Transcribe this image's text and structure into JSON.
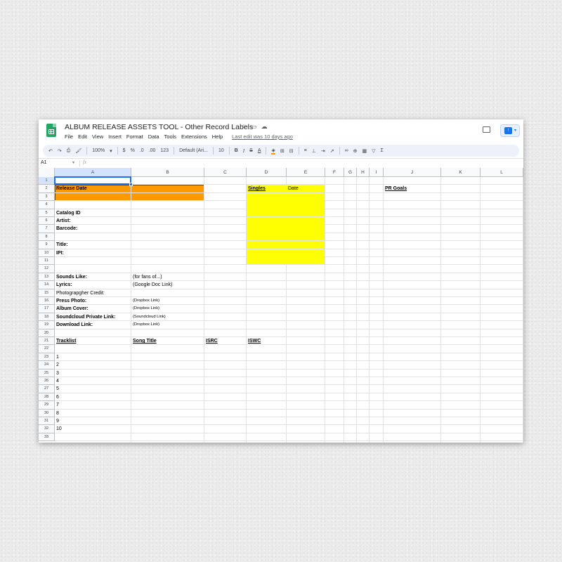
{
  "header": {
    "title": "ALBUM RELEASE ASSETS TOOL - Other Record Labels",
    "menu": [
      "File",
      "Edit",
      "View",
      "Insert",
      "Format",
      "Data",
      "Tools",
      "Extensions",
      "Help"
    ],
    "last_edit": "Last edit was 10 days ago"
  },
  "toolbar": {
    "zoom": "100%",
    "currency": "$",
    "percent": "%",
    "dec_decrease": ".0",
    "dec_increase": ".00",
    "format_123": "123",
    "font": "Default (Ari...",
    "font_size": "10",
    "bold": "B",
    "italic": "I",
    "strike": "S",
    "text_color": "A"
  },
  "formula_bar": {
    "cell_ref": "A1",
    "fx": "fx"
  },
  "columns": [
    "A",
    "B",
    "C",
    "D",
    "E",
    "F",
    "G",
    "H",
    "I",
    "J",
    "K",
    "L"
  ],
  "selected_column": "A",
  "selected_row": "1",
  "rows": [
    "1",
    "2",
    "3",
    "4",
    "5",
    "6",
    "7",
    "8",
    "9",
    "10",
    "11",
    "12",
    "13",
    "14",
    "15",
    "16",
    "17",
    "18",
    "19",
    "20",
    "21",
    "22",
    "23",
    "24",
    "25",
    "26",
    "27",
    "28",
    "29",
    "30",
    "31",
    "32",
    "33"
  ],
  "colors": {
    "orange": "#ff9900",
    "yellow": "#ffff00",
    "selection": "#1a73e8"
  },
  "cells": {
    "a2": "Release Date",
    "d2": "Singles",
    "e2": "Date",
    "j2": "PR Goals",
    "a5": "Catalog ID",
    "a6": "Artist:",
    "a7": "Barcode:",
    "a9": "Title:",
    "a10": "IPI:",
    "a13": "Sounds Like:",
    "b13": "(for fans of...)",
    "a14": "Lyrics:",
    "b14": "(Google Doc Link)",
    "a15": "Photograpgher Credit:",
    "a16": "Press Photo:",
    "b16": "(Dropbox Link)",
    "a17": "Album Cover:",
    "b17": "(Dropbox Link)",
    "a18": "Soundcloud Private Link:",
    "b18": "(Soundcloud Link)",
    "a19": "Download Link:",
    "b19": "(Dropbox Link)",
    "a21": "Tracklist",
    "b21": "Song Title",
    "c21": "ISRC",
    "d21": "ISWC",
    "tracks": [
      "1",
      "2",
      "3",
      "4",
      "5",
      "6",
      "7",
      "8",
      "9",
      "10"
    ]
  }
}
